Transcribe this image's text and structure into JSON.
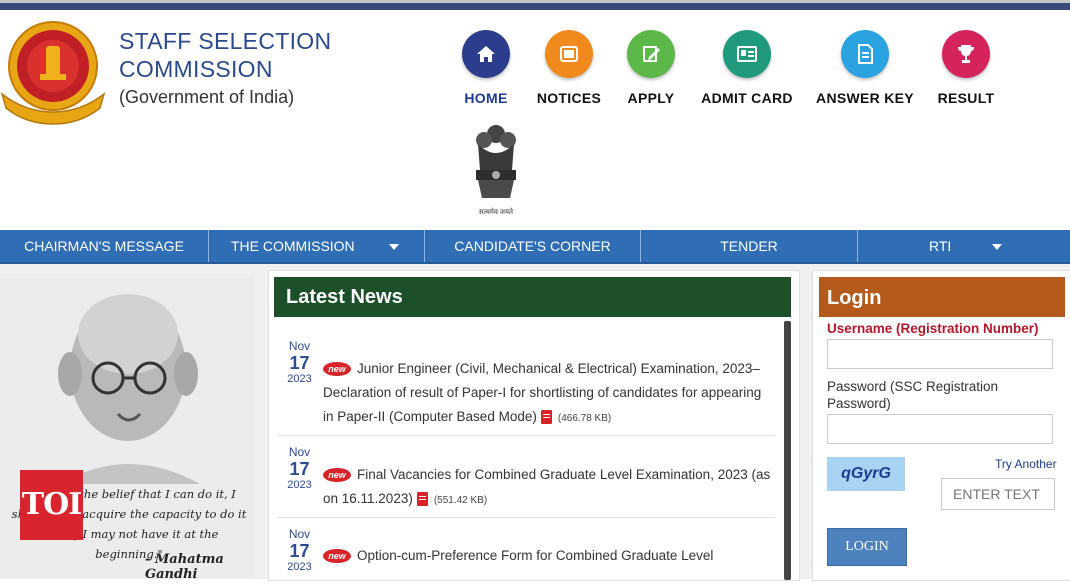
{
  "org": {
    "line1": "STAFF SELECTION",
    "line2": "COMMISSION",
    "line3": "(Government of India)",
    "emblem_caption": "सत्यमेव जयते"
  },
  "icon_nav": [
    {
      "label": "HOME",
      "icon": "home-icon",
      "color": "#2b3d8c"
    },
    {
      "label": "NOTICES",
      "icon": "notices-icon",
      "color": "#f08a1c"
    },
    {
      "label": "APPLY",
      "icon": "apply-icon",
      "color": "#5cb848"
    },
    {
      "label": "ADMIT CARD",
      "icon": "admit-card-icon",
      "color": "#1f9a7c"
    },
    {
      "label": "ANSWER KEY",
      "icon": "answer-key-icon",
      "color": "#2aa3e0"
    },
    {
      "label": "RESULT",
      "icon": "result-icon",
      "color": "#d4245b"
    }
  ],
  "menu": [
    {
      "label": "CHAIRMAN'S MESSAGE"
    },
    {
      "label": "THE COMMISSION"
    },
    {
      "label": "CANDIDATE'S CORNER"
    },
    {
      "label": "TENDER"
    },
    {
      "label": "RTI"
    }
  ],
  "quote": {
    "text": "\"If I have the belief that I can do it, I shall surely acquire the capacity to do it even if I may not have it at the beginning.\"",
    "author": "- Mahatma Gandhi"
  },
  "watermark": "TOI",
  "news": {
    "title": "Latest News",
    "badge": "new",
    "items": [
      {
        "month": "Nov",
        "day": "17",
        "year": "2023",
        "text": "Junior Engineer (Civil, Mechanical & Electrical) Examination, 2023– Declaration of result of Paper-I for shortlisting of candidates for appearing in Paper-II (Computer Based Mode)",
        "size": "(466.78 KB)"
      },
      {
        "month": "Nov",
        "day": "17",
        "year": "2023",
        "text": "Final Vacancies for Combined Graduate Level Examination, 2023 (as on 16.11.2023)",
        "size": "(551.42 KB)"
      },
      {
        "month": "Nov",
        "day": "17",
        "year": "2023",
        "text": "Option-cum-Preference Form for Combined Graduate Level",
        "size": ""
      }
    ]
  },
  "login": {
    "title": "Login",
    "username_label": "Username (Registration Number)",
    "password_label": "Password (SSC Registration Password)",
    "captcha": "qGyrG",
    "try_another": "Try Another",
    "captcha_placeholder": "ENTER TEXT",
    "button": "LOGIN"
  },
  "colors": {
    "menu_bar": "#2f6db5",
    "news_header": "#1b5029",
    "login_header": "#b45a1d",
    "username_label": "#b5182a"
  }
}
